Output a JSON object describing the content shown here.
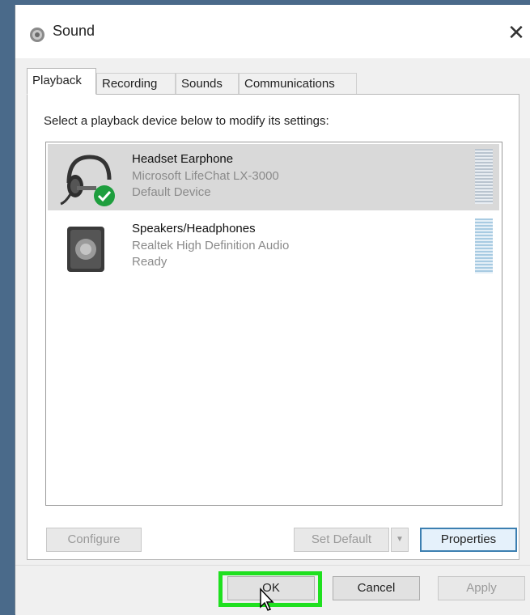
{
  "window": {
    "title": "Sound",
    "close_glyph": "✕"
  },
  "tabs": [
    {
      "label": "Playback",
      "active": true
    },
    {
      "label": "Recording",
      "active": false
    },
    {
      "label": "Sounds",
      "active": false
    },
    {
      "label": "Communications",
      "active": false
    }
  ],
  "panel": {
    "instruction": "Select a playback device below to modify its settings:"
  },
  "devices": [
    {
      "name": "Headset Earphone",
      "description": "Microsoft LifeChat LX-3000",
      "status": "Default Device",
      "icon": "headset-icon",
      "selected": true,
      "default_badge": "checkmark-badge-icon"
    },
    {
      "name": "Speakers/Headphones",
      "description": "Realtek High Definition Audio",
      "status": "Ready",
      "icon": "speaker-icon",
      "selected": false
    }
  ],
  "buttons": {
    "configure": "Configure",
    "set_default": "Set Default",
    "properties": "Properties",
    "ok": "OK",
    "cancel": "Cancel",
    "apply": "Apply"
  },
  "colors": {
    "highlight": "#1fe01f",
    "selected_row": "#d9d9d9",
    "focus_border": "#3c7fb1",
    "badge_green": "#1e9e3e"
  }
}
